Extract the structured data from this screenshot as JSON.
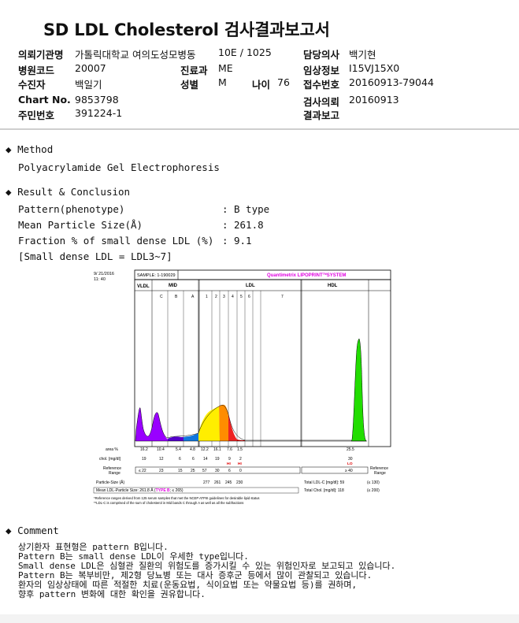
{
  "report_title": "SD LDL Cholesterol 검사결과보고서",
  "info": {
    "institution_label": "의뢰기관명",
    "institution_value": "가톨릭대학교 여의도성모병동",
    "ward_value": "10E / 1025",
    "doctor_label": "담당의사",
    "doctor_value": "백기현",
    "hospital_code_label": "병원코드",
    "hospital_code_value": "20007",
    "dept_label": "진료과",
    "dept_value": "ME",
    "clinical_label": "임상정보",
    "clinical_value": "I15VJ15X0",
    "patient_label": "수진자",
    "patient_value": "백일기",
    "sex_label": "성별",
    "sex_value": "M",
    "age_label": "나이",
    "age_value": "76",
    "receipt_label": "접수번호",
    "receipt_value": "20160913-79044",
    "chart_label": "Chart No.",
    "chart_value": "9853798",
    "request_label": "검사의뢰",
    "request_value": "20160913",
    "rrn_label": "주민번호",
    "rrn_value": "391224-1",
    "result_report_label": "결과보고",
    "result_report_value": ""
  },
  "method": {
    "heading": "Method",
    "text": "Polyacrylamide Gel Electrophoresis"
  },
  "result": {
    "heading": "Result & Conclusion",
    "pattern_label": "Pattern(phenotype)",
    "pattern_value": "B type",
    "size_label": "Mean Particle Size(Å)",
    "size_value": "261.8",
    "fraction_label": "Fraction % of small dense LDL (%)",
    "fraction_value": "9.1",
    "note": "[Small dense LDL = LDL3~7]"
  },
  "lipoprint": {
    "date": "9/ 21/2016",
    "time": "11: 40",
    "sample": "SAMPLE:   1-190029",
    "brand": "Quantimetrix LIPOPRINT",
    "brand_tm": "TM",
    "brand_system": "SYSTEM",
    "region_vldl": "VLDL",
    "region_mid": "MID",
    "region_ldl": "LDL",
    "region_hdl": "HDL",
    "mid_sub": [
      "C",
      "B",
      "A"
    ],
    "ldl_sub": [
      "1",
      "2",
      "3",
      "4",
      "5",
      "6",
      "7"
    ],
    "area_label": "area %",
    "area_values": [
      "16.2",
      "10.4",
      "5.4",
      "4.8",
      "12.2",
      "16.1",
      "7.6",
      "1.5",
      "",
      "",
      "",
      "25.5"
    ],
    "chol_label": "chol. [mg/dl]",
    "chol_values": [
      "19",
      "12",
      "6",
      "6",
      "14",
      "19",
      "9",
      "2",
      "",
      "",
      "",
      "30"
    ],
    "flags": [
      "HI",
      "HI",
      "LO"
    ],
    "ref_label": "Reference Range",
    "ref_values": [
      "≤ 22",
      "23",
      "15",
      "25",
      "57",
      "30",
      "6",
      "0"
    ],
    "ref_hdl": "≥ 40",
    "ref_label_right": "Reference Range",
    "particle_size_label": "Particle-Size (Å)",
    "particle_sizes": [
      "277",
      "261",
      "245",
      "230"
    ],
    "mean_label": "Mean LDL-Particle Size:   261.8 Å  (",
    "mean_type": "TYPE B",
    "mean_tail": "; ≤ 265)",
    "total_ldl": "Total LDL-C [mg/dl]:  59",
    "total_ldl_ref": "(≤ 130)",
    "total_chol": "Total Chol. [mg/dl]:  118",
    "total_chol_ref": "(≤ 200)",
    "foot1": "*Reference ranges derived from 125 serum samples that met the NCEP ATPIII guidelines for desirable lipid status",
    "foot2": "**LDL-C is comprised of the sum of cholesterol in Mid bands C through A as well as all the subfractions"
  },
  "comment": {
    "heading": "Comment",
    "lines": [
      "상기환자 표현형은 pattern B입니다.",
      "Pattern B는 small dense LDL이 우세한 type입니다.",
      "Small dense LDL은 심혈관 질환의 위험도를 증가시킬 수 있는 위험인자로 보고되고 있습니다.",
      "Pattern B는 복부비만, 제2형 당뇨병 또는 대사 증후군 등에서 많이 관찰되고 있습니다.",
      "환자의 임상상태에 따른 적절한 치료(운동요법, 식이요법 또는 약물요법 등)를 권하며,",
      "향후 pattern 변화에 대한 확인을 권유합니다."
    ]
  }
}
